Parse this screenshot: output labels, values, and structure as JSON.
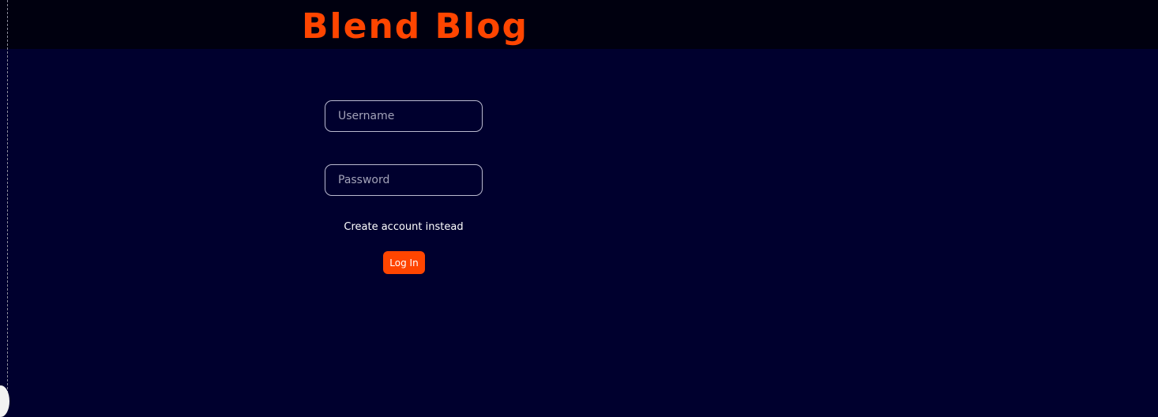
{
  "header": {
    "title": "Blend Blog"
  },
  "form": {
    "username_placeholder": "Username",
    "password_placeholder": "Password",
    "switch_link": "Create account instead",
    "submit_label": "Log In"
  },
  "colors": {
    "page_background": "#00002e",
    "header_background": "#00000f",
    "accent": "#ff4500",
    "text": "#ffffff"
  }
}
